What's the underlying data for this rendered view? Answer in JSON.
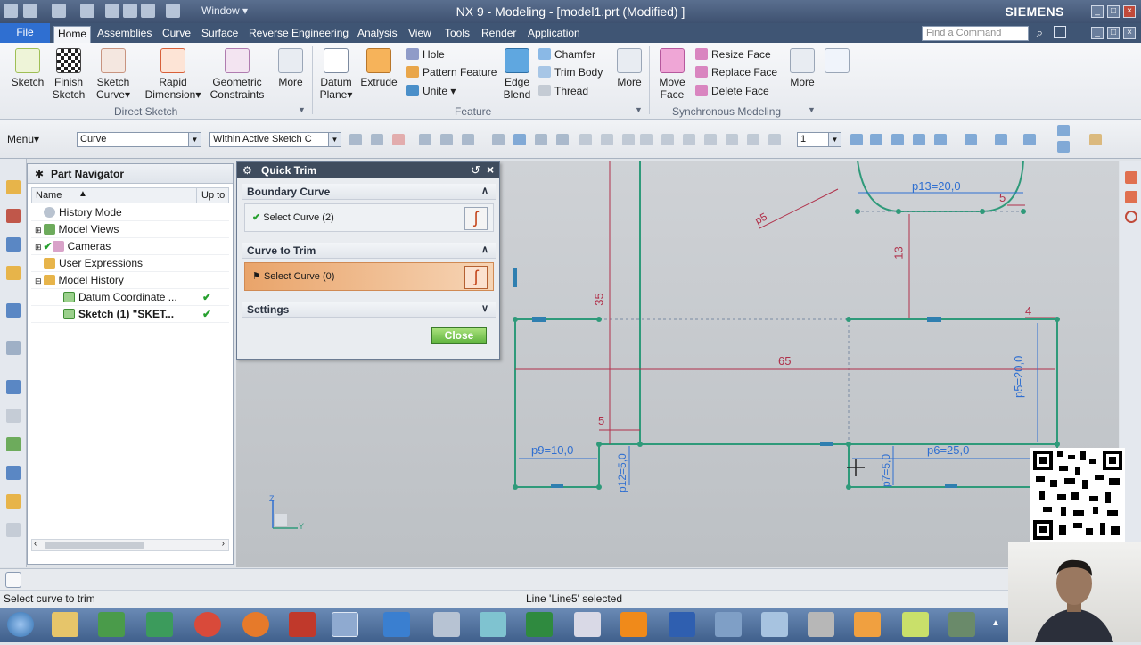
{
  "window": {
    "title": "NX 9 - Modeling - [model1.prt (Modified) ]",
    "brand": "SIEMENS",
    "window_menu": "Window ▾"
  },
  "menu_tabs": [
    "File",
    "Home",
    "Assemblies",
    "Curve",
    "Surface",
    "Reverse Engineering",
    "Analysis",
    "View",
    "Tools",
    "Render",
    "Application"
  ],
  "active_tab": "Home",
  "find_command_placeholder": "Find a Command",
  "ribbon": {
    "sketch": "Sketch",
    "finish_sketch": [
      "Finish",
      "Sketch"
    ],
    "sketch_curve": [
      "Sketch",
      "Curve▾"
    ],
    "rapid_dimension": [
      "Rapid",
      "Dimension▾"
    ],
    "geometric_constraints": [
      "Geometric",
      "Constraints"
    ],
    "more1": "More",
    "direct_sketch_label": "Direct Sketch",
    "datum_plane": [
      "Datum",
      "Plane▾"
    ],
    "extrude": "Extrude",
    "hole": "Hole",
    "pattern_feature": "Pattern Feature",
    "unite": "Unite ▾",
    "edge_blend": [
      "Edge",
      "Blend"
    ],
    "chamfer": "Chamfer",
    "trim_body": "Trim Body",
    "thread": "Thread",
    "more2": "More",
    "feature_label": "Feature",
    "move_face": [
      "Move",
      "Face"
    ],
    "resize_face": "Resize Face",
    "replace_face": "Replace Face",
    "delete_face": "Delete Face",
    "more3": "More",
    "sync_label": "Synchronous Modeling"
  },
  "toolbar": {
    "menu": "Menu▾",
    "filter": "Curve",
    "scope": "Within Active Sketch C",
    "count": "1"
  },
  "navigator": {
    "title": "Part Navigator",
    "col_name": "Name",
    "col_up": "Up to",
    "rows": [
      {
        "label": "History Mode",
        "check": ""
      },
      {
        "label": "Model Views",
        "check": ""
      },
      {
        "label": "Cameras",
        "check": ""
      },
      {
        "label": "User Expressions",
        "check": ""
      },
      {
        "label": "Model History",
        "check": ""
      },
      {
        "label": "Datum Coordinate ...",
        "check": "✔"
      },
      {
        "label": "Sketch (1) \"SKET...",
        "check": "✔"
      }
    ]
  },
  "quick_trim": {
    "title": "Quick Trim",
    "boundary_curve": "Boundary Curve",
    "boundary_select": "Select Curve (2)",
    "curve_to_trim": "Curve to Trim",
    "trim_select": "Select Curve (0)",
    "settings": "Settings",
    "close": "Close"
  },
  "dimensions": {
    "p13": "p13=20,0",
    "p5top": "p5",
    "d13": "13",
    "d5a": "5",
    "d35": "35",
    "d4": "4",
    "d65": "65",
    "p5": "p5=20,0",
    "d5b": "5",
    "p9": "p9=10,0",
    "p12": "p12=5,0",
    "p6": "p6=25,0",
    "p7": "p7=5,0"
  },
  "triad": {
    "z": "Z",
    "y": "Y"
  },
  "status": {
    "prompt": "Select curve to trim",
    "message": "Line 'Line5' selected"
  },
  "colors": {
    "sketch_green": "#2f9a7a",
    "dimension_red": "#b0304a",
    "dimension_blue": "#2f6fd1",
    "accent_orange": "#f0a860"
  }
}
